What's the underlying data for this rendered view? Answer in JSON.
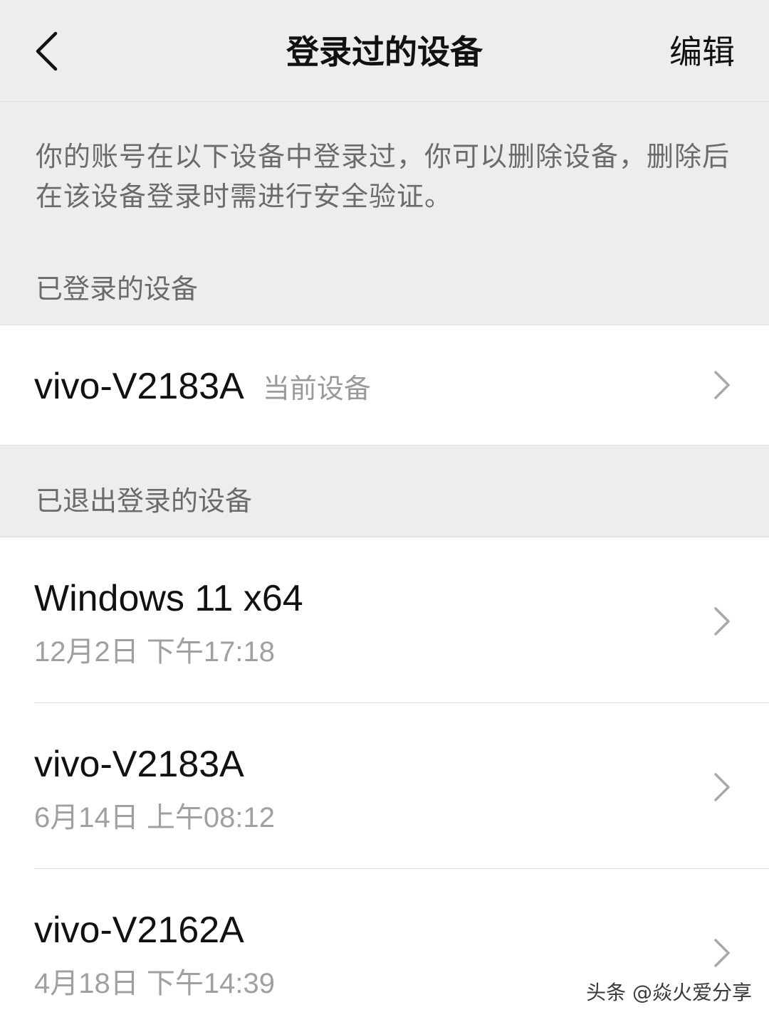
{
  "header": {
    "title": "登录过的设备",
    "edit_label": "编辑",
    "back_icon": "chevron-left-icon"
  },
  "description": "你的账号在以下设备中登录过，你可以删除设备，删除后在该设备登录时需进行安全验证。",
  "logged_in_section": {
    "title": "已登录的设备",
    "devices": [
      {
        "name": "vivo-V2183A",
        "tag": "当前设备"
      }
    ]
  },
  "logged_out_section": {
    "title": "已退出登录的设备",
    "devices": [
      {
        "name": "Windows 11 x64",
        "time": "12月2日 下午17:18"
      },
      {
        "name": "vivo-V2183A",
        "time": "6月14日 上午08:12"
      },
      {
        "name": "vivo-V2162A",
        "time": "4月18日 下午14:39"
      }
    ]
  },
  "watermark": "头条 @焱火爱分享",
  "colors": {
    "background": "#ededed",
    "list_background": "#ffffff",
    "secondary_text": "#a0a0a0",
    "primary_text": "#111111"
  }
}
